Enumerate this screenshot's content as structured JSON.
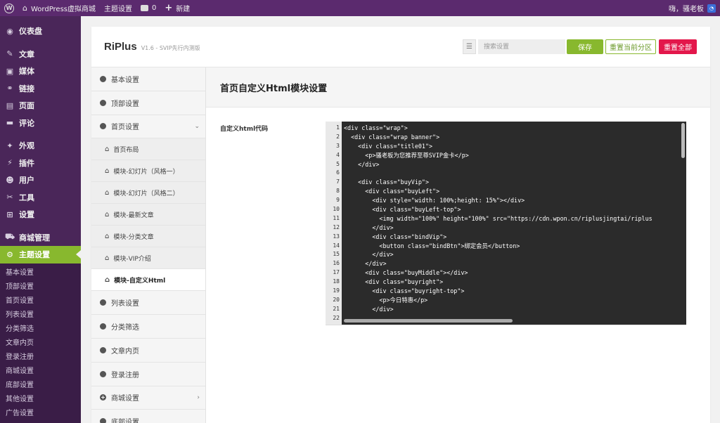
{
  "adminbar": {
    "wp_logo": "W",
    "site_name": "WordPress虚拟商城",
    "theme_settings": "主题设置",
    "comments_count": "0",
    "new_label": "新建",
    "greeting": "嗨，骚老板",
    "icons": {
      "home": "home-icon",
      "comment": "comment-bubble-icon",
      "plus": "plus-icon"
    }
  },
  "admin_menu": {
    "items": [
      {
        "label": "仪表盘",
        "icon": "◉"
      },
      {
        "label": "文章",
        "icon": "✎"
      },
      {
        "label": "媒体",
        "icon": "▣"
      },
      {
        "label": "链接",
        "icon": "⚭"
      },
      {
        "label": "页面",
        "icon": "▤"
      },
      {
        "label": "评论",
        "icon": "▬"
      },
      {
        "label": "外观",
        "icon": "✦"
      },
      {
        "label": "插件",
        "icon": "⚡"
      },
      {
        "label": "用户",
        "icon": "☻"
      },
      {
        "label": "工具",
        "icon": "✂"
      },
      {
        "label": "设置",
        "icon": "⊞"
      },
      {
        "label": "商城管理",
        "icon": "⛟"
      },
      {
        "label": "主题设置",
        "icon": "⚙"
      }
    ],
    "submenu": [
      "基本设置",
      "顶部设置",
      "首页设置",
      "列表设置",
      "分类筛选",
      "文章内页",
      "登录注册",
      "商城设置",
      "底部设置",
      "其他设置",
      "广告设置"
    ]
  },
  "header": {
    "brand": "RiPlus",
    "version": "V1.6 - SVIP先行内测版",
    "search_placeholder": "搜索设置",
    "save": "保存",
    "reset_section": "重置当前分区",
    "reset_all": "重置全部"
  },
  "nav": {
    "top_items": [
      "基本设置",
      "顶部设置",
      "首页设置"
    ],
    "sub_items": [
      "首页布局",
      "模块-幻灯片（风格一）",
      "模块-幻灯片（风格二）",
      "模块-最新文章",
      "模块-分类文章",
      "模块-VIP介绍",
      "模块-自定义Html"
    ],
    "bottom_items": [
      "列表设置",
      "分类筛选",
      "文章内页",
      "登录注册",
      "商城设置",
      "底部设置"
    ]
  },
  "content": {
    "title": "首页自定义Html模块设置",
    "field_label": "自定义html代码"
  },
  "code_lines": [
    "<div class=\"wrap\">",
    "  <div class=\"wrap banner\">",
    "    <div class=\"title01\">",
    "      <p>骚老板为您推荐至尊SVIP金卡</p>",
    "    </div>",
    "",
    "    <div class=\"buyVip\">",
    "      <div class=\"buyLeft\">",
    "        <div style=\"width: 100%;height: 15%\"></div>",
    "        <div class=\"buyLeft-top\">",
    "          <img width=\"100%\" height=\"100%\" src=\"https://cdn.wpon.cn/riplusjingtai/riplus",
    "        </div>",
    "        <div class=\"bindVip\">",
    "          <button class=\"bindBtn\">绑定会员</button>",
    "        </div>",
    "      </div>",
    "      <div class=\"buyMiddle\"></div>",
    "      <div class=\"buyright\">",
    "        <div class=\"buyright-top\">",
    "          <p>今日特惠</p>",
    "        </div>",
    ""
  ],
  "line_numbers": [
    "1",
    "2",
    "3",
    "4",
    "5",
    "6",
    "7",
    "8",
    "9",
    "10",
    "11",
    "12",
    "13",
    "14",
    "15",
    "16",
    "17",
    "18",
    "19",
    "20",
    "21",
    "22"
  ]
}
